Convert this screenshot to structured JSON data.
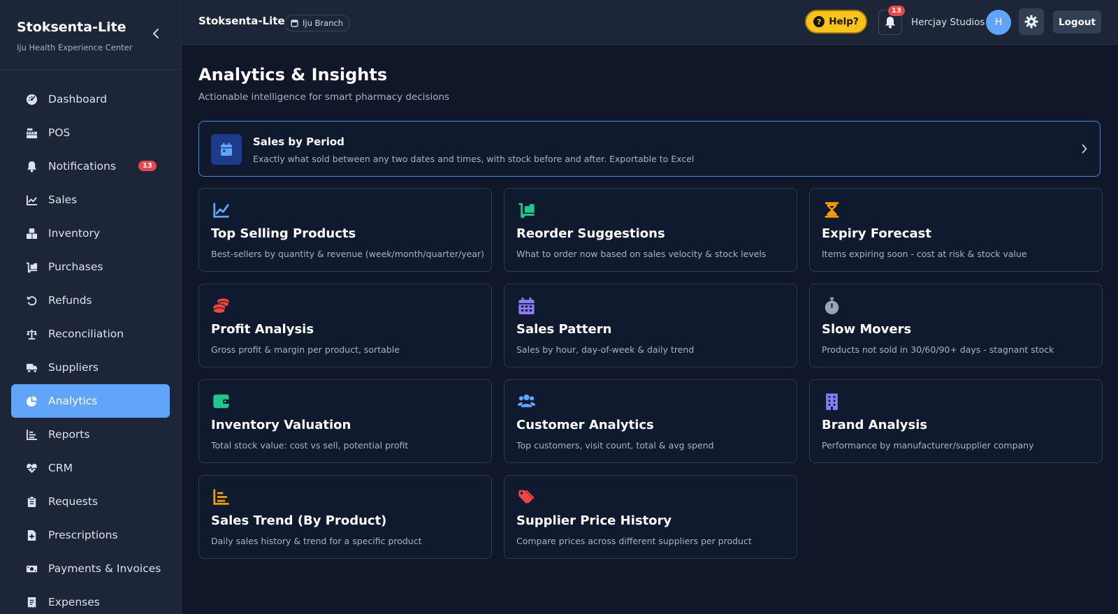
{
  "app": {
    "name": "Stoksenta-Lite",
    "subtitle": "Iju Health Experience Center"
  },
  "sidebar": {
    "items": [
      {
        "label": "Dashboard",
        "icon": "gauge-icon"
      },
      {
        "label": "POS",
        "icon": "cash-register-icon"
      },
      {
        "label": "Notifications",
        "icon": "bell-icon",
        "badge": "13"
      },
      {
        "label": "Sales",
        "icon": "line-chart-icon"
      },
      {
        "label": "Inventory",
        "icon": "boxes-icon"
      },
      {
        "label": "Purchases",
        "icon": "dolly-icon"
      },
      {
        "label": "Refunds",
        "icon": "undo-icon"
      },
      {
        "label": "Reconciliation",
        "icon": "scale-icon"
      },
      {
        "label": "Suppliers",
        "icon": "truck-icon"
      },
      {
        "label": "Analytics",
        "icon": "pie-chart-icon",
        "active": true
      },
      {
        "label": "Reports",
        "icon": "bar-chart-icon"
      },
      {
        "label": "CRM",
        "icon": "heart-pulse-icon"
      },
      {
        "label": "Requests",
        "icon": "clipboard-icon"
      },
      {
        "label": "Prescriptions",
        "icon": "file-medical-icon"
      },
      {
        "label": "Payments & Invoices",
        "icon": "money-bill-icon"
      },
      {
        "label": "Expenses",
        "icon": "receipt-icon"
      }
    ]
  },
  "header": {
    "title": "Stoksenta-Lite",
    "branch": "Iju Branch",
    "help_label": "Help?",
    "notification_count": "13",
    "user_name": "Hercjay Studios",
    "avatar_initial": "H",
    "logout_label": "Logout"
  },
  "main": {
    "title": "Analytics & Insights",
    "subtitle": "Actionable intelligence for smart pharmacy decisions",
    "featured": {
      "title": "Sales by Period",
      "description": "Exactly what sold between any two dates and times, with stock before and after. Exportable to Excel",
      "icon": "calendar-icon"
    },
    "cards": [
      {
        "title": "Top Selling Products",
        "description": "Best-sellers by quantity & revenue (week/month/quarter/year)",
        "icon": "trend-chart-icon",
        "color": "#60a5fa"
      },
      {
        "title": "Reorder Suggestions",
        "description": "What to order now based on sales velocity & stock levels",
        "icon": "dolly-icon",
        "color": "#22c58b"
      },
      {
        "title": "Expiry Forecast",
        "description": "Items expiring soon - cost at risk & stock value",
        "icon": "hourglass-icon",
        "color": "#f59e0b"
      },
      {
        "title": "Profit Analysis",
        "description": "Gross profit & margin per product, sortable",
        "icon": "coins-icon",
        "color": "#ef4444"
      },
      {
        "title": "Sales Pattern",
        "description": "Sales by hour, day-of-week & daily trend",
        "icon": "calendar-grid-icon",
        "color": "#8b7cf6"
      },
      {
        "title": "Slow Movers",
        "description": "Products not sold in 30/60/90+ days - stagnant stock",
        "icon": "stopwatch-icon",
        "color": "#9aa4b2"
      },
      {
        "title": "Inventory Valuation",
        "description": "Total stock value: cost vs sell, potential profit",
        "icon": "wallet-icon",
        "color": "#22c58b"
      },
      {
        "title": "Customer Analytics",
        "description": "Top customers, visit count, total & avg spend",
        "icon": "users-icon",
        "color": "#60a5fa"
      },
      {
        "title": "Brand Analysis",
        "description": "Performance by manufacturer/supplier company",
        "icon": "building-icon",
        "color": "#8b7cf6"
      },
      {
        "title": "Sales Trend (By Product)",
        "description": "Daily sales history & trend for a specific product",
        "icon": "bar-chart-icon",
        "color": "#f59e0b"
      },
      {
        "title": "Supplier Price History",
        "description": "Compare prices across different suppliers per product",
        "icon": "tags-icon",
        "color": "#ef4444"
      }
    ]
  },
  "colors": {
    "accent": "#60a5fa",
    "background": "#0f1729",
    "sidebar": "#1c2638",
    "help": "#f8c31b",
    "badge": "#e5484d"
  }
}
